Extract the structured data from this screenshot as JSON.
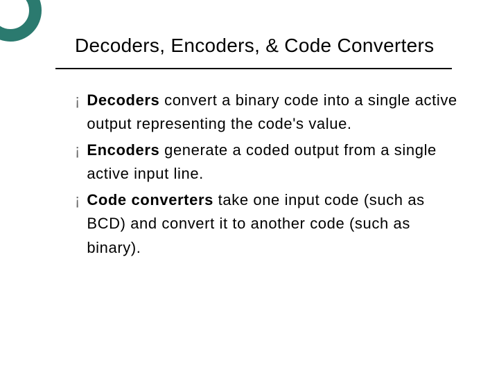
{
  "slide": {
    "title": "Decoders, Encoders, & Code Converters",
    "bullets": [
      {
        "term": "Decoders",
        "rest": " convert a binary code into a single active output representing the code's value."
      },
      {
        "term": "Encoders",
        "rest": " generate a coded output from a single active input line."
      },
      {
        "term": "Code converters",
        "rest": " take one input code (such as BCD) and convert it to another code (such as binary)."
      }
    ],
    "bullet_glyph": "¡",
    "accent_color": "#2b7a6f"
  }
}
